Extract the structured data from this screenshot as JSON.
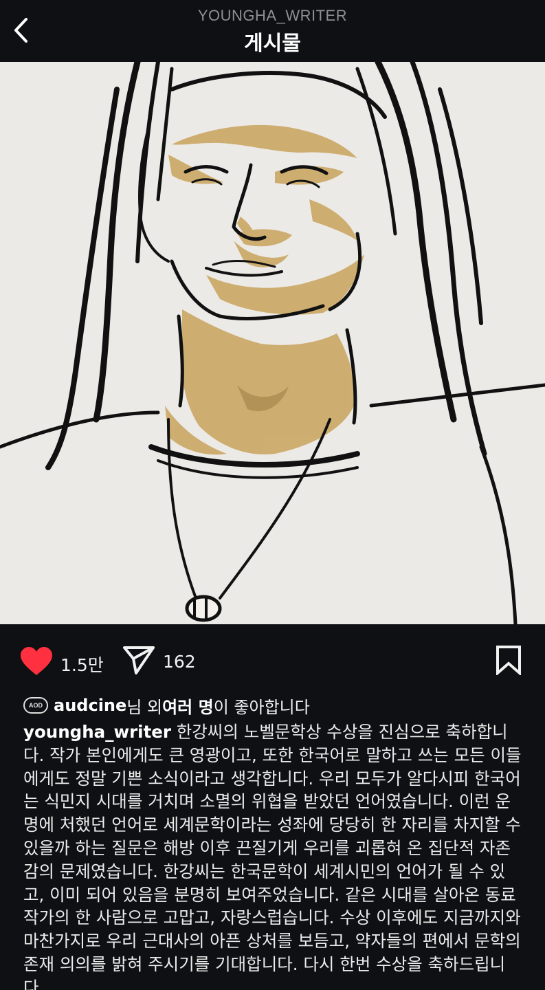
{
  "header": {
    "account": "YOUNGHA_WRITER",
    "title": "게시물",
    "back_icon": "chevron-left-icon"
  },
  "post": {
    "image_alt": "portrait-illustration"
  },
  "actions": {
    "like_count": "1.5만",
    "share_count": "162",
    "liked": true,
    "colors": {
      "heart": "#ff3040",
      "icons": "#f2f2f2"
    }
  },
  "likes": {
    "avatar_text": "AOD",
    "user": "audcine",
    "suffix_1": "님 외 ",
    "others": "여러 명",
    "suffix_2": "이 좋아합니다"
  },
  "caption": {
    "username": "youngha_writer",
    "text": " 한강씨의 노벨문학상 수상을 진심으로 축하합니다. 작가 본인에게도 큰 영광이고, 또한 한국어로 말하고 쓰는 모든 이들에게도 정말 기쁜 소식이라고 생각합니다. 우리 모두가 알다시피 한국어는 식민지 시대를 거치며 소멸의 위협을 받았던 언어였습니다. 이런 운명에 처했던 언어로 세계문학이라는 성좌에 당당히 한 자리를 차지할 수 있을까 하는 질문은 해방 이후 끈질기게 우리를 괴롭혀 온 집단적 자존감의 문제였습니다. 한강씨는 한국문학이 세계시민의 언어가 될 수 있고, 이미 되어 있음을 분명히 보여주었습니다. 같은 시대를 살아온 동료 작가의 한 사람으로 고맙고, 자랑스럽습니다. 수상 이후에도 지금까지와 마찬가지로 우리 근대사의 아픈 상처를 보듬고, 약자들의 편에서 문학의 존재 의의를 밝혀 주시기를 기대합니다. 다시 한번 수상을 축하드립니다."
  }
}
